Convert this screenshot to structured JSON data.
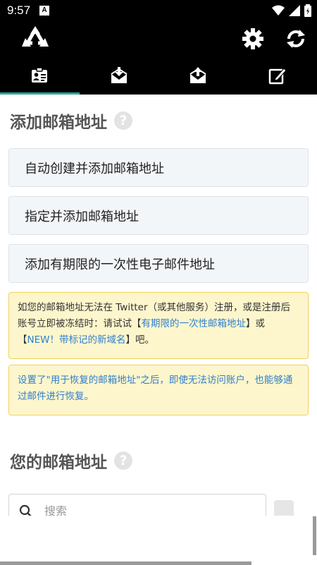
{
  "status": {
    "time": "9:57",
    "notification_letter": "A"
  },
  "appbar": {
    "logo_icon": "recycle-icon",
    "settings_icon": "gear-icon",
    "refresh_icon": "refresh-icon"
  },
  "tabs": [
    {
      "icon": "contact-card-icon",
      "active": true
    },
    {
      "icon": "mail-download-icon",
      "active": false
    },
    {
      "icon": "mail-upload-icon",
      "active": false
    },
    {
      "icon": "edit-icon",
      "active": false
    }
  ],
  "add_section": {
    "title": "添加邮箱地址",
    "help": "?",
    "buttons": [
      "自动创建并添加邮箱地址",
      "指定并添加邮箱地址",
      "添加有期限的一次性电子邮件地址"
    ]
  },
  "note1": {
    "text_before": "如您的邮箱地址无法在 Twitter（或其他服务）注册，或是注册后账号立即被冻结时：请试试【",
    "link1": "有期限的一次性邮箱地址",
    "text_mid": "】或【",
    "link2": "NEW！带标记的新域名",
    "text_after": "】吧。"
  },
  "note2": {
    "text": "设置了\"用于恢复的邮箱地址\"之后，即使无法访问账户，也能够通过邮件进行恢复。"
  },
  "your_section": {
    "title": "您的邮箱地址",
    "help": "?"
  },
  "search": {
    "placeholder": "搜索"
  },
  "colors": {
    "accent": "#2aa59b",
    "link": "#2f7fcf",
    "note_bg": "#fdf6cc",
    "note_border": "#f1d25a"
  }
}
